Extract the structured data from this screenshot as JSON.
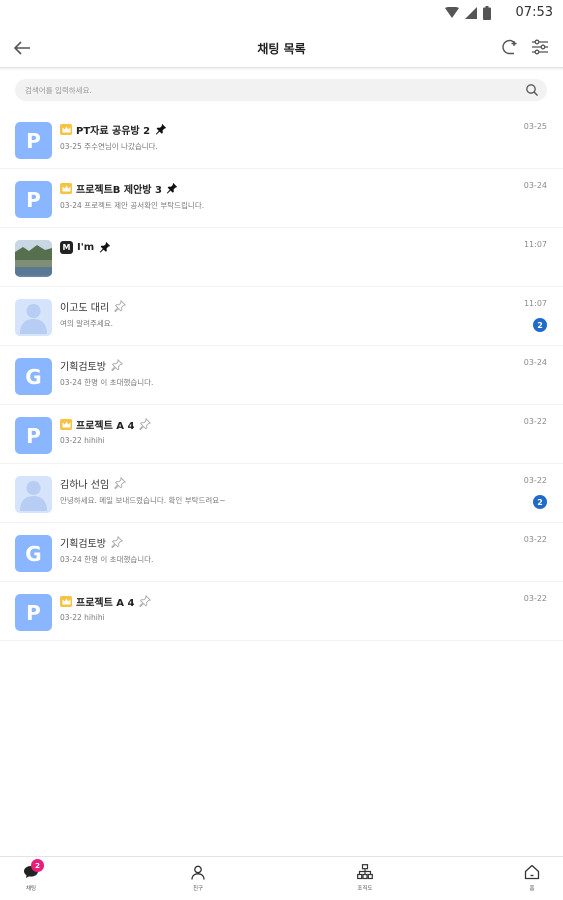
{
  "status_bar": {
    "time": "07:53"
  },
  "header": {
    "title": "채팅 목록"
  },
  "search": {
    "placeholder": "검색어를 입력하세요."
  },
  "chats": [
    {
      "name": "PT자료 공유방 2",
      "preview": "03-25 주수연님이 나갔습니다.",
      "time": "03-25",
      "avatar_type": "letter",
      "avatar_letter": "P",
      "crown": true,
      "pinned": true
    },
    {
      "name": "프로젝트B 제안방 3",
      "preview": "03-24 프로젝트 제안 공서확인 부탁드립니다.",
      "time": "03-24",
      "avatar_type": "letter",
      "avatar_letter": "P",
      "crown": true,
      "pinned": true
    },
    {
      "name": "I'm",
      "preview": "",
      "time": "11:07",
      "avatar_type": "photo",
      "badge_letter": "M",
      "pinned": true
    },
    {
      "name": "이고도 대리",
      "preview": "여의 알려주세요.",
      "time": "11:07",
      "avatar_type": "person",
      "pinned": false,
      "unread": "2"
    },
    {
      "name": "기획검토방",
      "preview": "03-24 한명 이 초대했습니다.",
      "time": "03-24",
      "avatar_type": "letter",
      "avatar_letter": "G",
      "pinned": false
    },
    {
      "name": "프로젝트 A 4",
      "preview": "03-22 hihihi",
      "time": "03-22",
      "avatar_type": "letter",
      "avatar_letter": "P",
      "crown": true,
      "pinned": false
    },
    {
      "name": "김하나 선임",
      "preview": "안녕하세요. 메일 보내드렸습니다. 확인 부탁드려요~",
      "time": "03-22",
      "avatar_type": "person",
      "pinned": false,
      "unread": "2"
    },
    {
      "name": "기획검토방",
      "preview": "03-24 한명 이 초대했습니다.",
      "time": "03-22",
      "avatar_type": "letter",
      "avatar_letter": "G",
      "pinned": false
    },
    {
      "name": "프로젝트 A 4",
      "preview": "03-22 hihihi",
      "time": "03-22",
      "avatar_type": "letter",
      "avatar_letter": "P",
      "crown": true,
      "pinned": false
    }
  ],
  "bottom_nav": [
    {
      "label": "채팅",
      "icon": "chat-icon",
      "badge": "2"
    },
    {
      "label": "친구",
      "icon": "person-icon"
    },
    {
      "label": "조직도",
      "icon": "org-chart-icon"
    },
    {
      "label": "홈",
      "icon": "home-icon"
    }
  ],
  "colors": {
    "avatar_letter_bg": "#8ab5ff",
    "avatar_person_bg": "#d5e3fb",
    "crown": "#f6c343",
    "unread_badge": "#1f6bc9",
    "nav_badge": "#e91e7a"
  }
}
